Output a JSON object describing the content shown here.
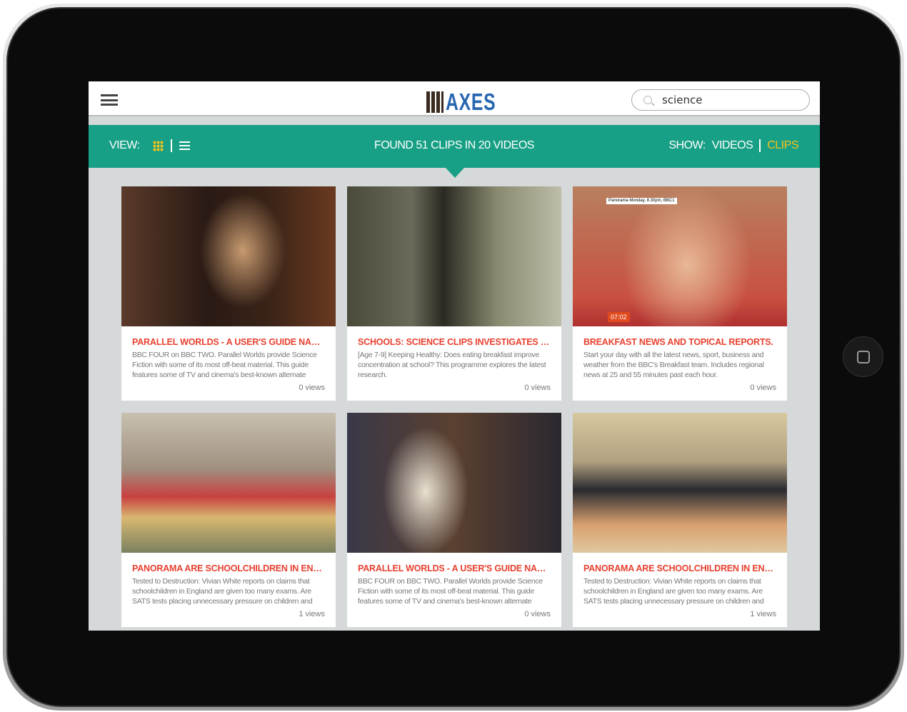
{
  "header": {
    "logo_text": "AXES",
    "search": {
      "value": "science"
    }
  },
  "toolbar": {
    "view_label": "VIEW:",
    "status": "FOUND 51 CLIPS IN 20 VIDEOS",
    "show_label": "SHOW:",
    "videos_label": "VIDEOS",
    "clips_label": "CLIPS",
    "active": "CLIPS"
  },
  "colors": {
    "accent": "#17a086",
    "title_red": "#e8402f",
    "highlight": "#f5c21b",
    "logo_blue": "#2866b0"
  },
  "clips": [
    {
      "title": "PARALLEL WORLDS - A USER'S GUIDE NARRAT...",
      "description": "BBC FOUR on BBC TWO. Parallel Worlds provide Science Fiction with some of its most off-beat material. This guide features some of TV and cinema's best-known alternate",
      "views": "0 views"
    },
    {
      "title": "SCHOOLS: SCIENCE CLIPS INVESTIGATES DOE...",
      "description": "[Age 7-9] Keeping Healthy: Does eating breakfast improve concentration at school? This programme explores the latest research.",
      "views": "0 views"
    },
    {
      "title": "BREAKFAST NEWS AND TOPICAL REPORTS.",
      "description": "Start your day with all the latest news, sport, business and weather from the BBC's Breakfast team. Includes regional news at 25 and 55 minutes past each hour.",
      "views": "0 views",
      "duration": "07:02",
      "overlay": "Panorama Monday, 8.30pm, BBC1"
    },
    {
      "title": "PANORAMA ARE SCHOOLCHILDREN IN ENGLA...",
      "description": "Tested to Destruction: Vivian White reports on claims that schoolchildren in England are given too many exams. Are SATS tests placing unnecessary pressure on children and",
      "views": "1 views"
    },
    {
      "title": "PARALLEL WORLDS - A USER'S GUIDE NARRAT...",
      "description": "BBC FOUR on BBC TWO. Parallel Worlds provide Science Fiction with some of its most off-beat material. This guide features some of TV and cinema's best-known alternate",
      "views": "0 views"
    },
    {
      "title": "PANORAMA ARE SCHOOLCHILDREN IN ENGLA...",
      "description": "Tested to Destruction: Vivian White reports on claims that schoolchildren in England are given too many exams. Are SATS tests placing unnecessary pressure on children and",
      "views": "1 views"
    }
  ]
}
